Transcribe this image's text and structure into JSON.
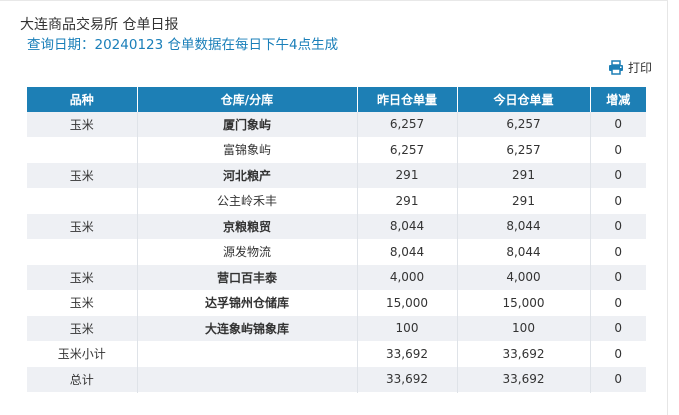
{
  "header": {
    "title": "大连商品交易所 仓单日报",
    "subtitle": "查询日期：20240123 仓单数据在每日下午4点生成",
    "print_label": "打印",
    "print_icon": "printer-icon"
  },
  "colors": {
    "header_bg": "#1d7fb5",
    "subtitle": "#1a7fb9",
    "row_alt": "#eef0f4"
  },
  "table": {
    "columns": [
      "品种",
      "仓库/分库",
      "昨日仓单量",
      "今日仓单量",
      "增减"
    ],
    "rows": [
      {
        "variety": "玉米",
        "warehouse": "厦门象屿",
        "yesterday": "6,257",
        "today": "6,257",
        "change": "0",
        "bold": true
      },
      {
        "variety": "",
        "warehouse": "富锦象屿",
        "yesterday": "6,257",
        "today": "6,257",
        "change": "0",
        "bold": false
      },
      {
        "variety": "玉米",
        "warehouse": "河北粮产",
        "yesterday": "291",
        "today": "291",
        "change": "0",
        "bold": true
      },
      {
        "variety": "",
        "warehouse": "公主岭禾丰",
        "yesterday": "291",
        "today": "291",
        "change": "0",
        "bold": false
      },
      {
        "variety": "玉米",
        "warehouse": "京粮粮贸",
        "yesterday": "8,044",
        "today": "8,044",
        "change": "0",
        "bold": true
      },
      {
        "variety": "",
        "warehouse": "源发物流",
        "yesterday": "8,044",
        "today": "8,044",
        "change": "0",
        "bold": false
      },
      {
        "variety": "玉米",
        "warehouse": "营口百丰泰",
        "yesterday": "4,000",
        "today": "4,000",
        "change": "0",
        "bold": true
      },
      {
        "variety": "玉米",
        "warehouse": "达孚锦州仓储库",
        "yesterday": "15,000",
        "today": "15,000",
        "change": "0",
        "bold": true
      },
      {
        "variety": "玉米",
        "warehouse": "大连象屿锦象库",
        "yesterday": "100",
        "today": "100",
        "change": "0",
        "bold": true
      },
      {
        "variety": "玉米小计",
        "warehouse": "",
        "yesterday": "33,692",
        "today": "33,692",
        "change": "0",
        "bold": false
      },
      {
        "variety": "总计",
        "warehouse": "",
        "yesterday": "33,692",
        "today": "33,692",
        "change": "0",
        "bold": false
      }
    ]
  }
}
